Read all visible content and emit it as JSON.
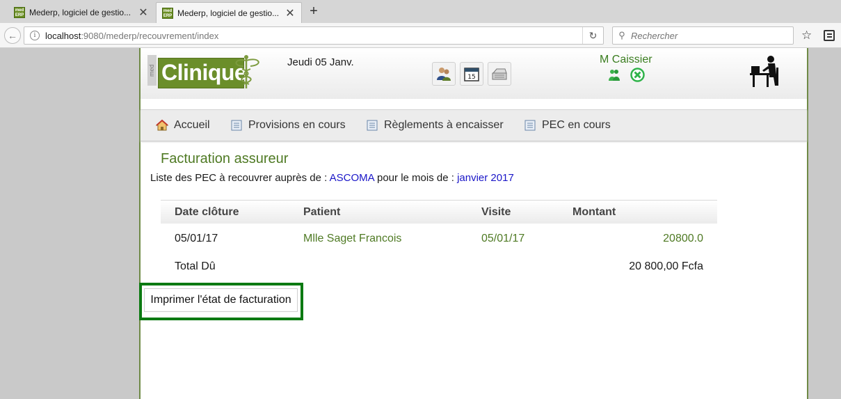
{
  "browser": {
    "tabs": [
      {
        "label": "Mederp, logiciel de gestio...",
        "favicon_text": "med ERP",
        "active": false
      },
      {
        "label": "Mederp, logiciel de gestio...",
        "favicon_text": "med ERP",
        "active": true
      }
    ],
    "url_host": "localhost",
    "url_path": ":9080/mederp/recouvrement/index",
    "search_placeholder": "Rechercher"
  },
  "header": {
    "logo_small": "med",
    "logo_text": "Clinique",
    "date": "Jeudi 05 Janv.",
    "calendar_day": "15",
    "user_name": "M Caissier",
    "quick_icons": [
      "patients-icon",
      "calendar-icon",
      "cash-register-icon"
    ]
  },
  "menu": [
    {
      "label": "Accueil",
      "icon": "home-icon"
    },
    {
      "label": "Provisions en cours",
      "icon": "document-icon"
    },
    {
      "label": "Règlements à encaisser",
      "icon": "document-icon"
    },
    {
      "label": "PEC en cours",
      "icon": "document-icon"
    }
  ],
  "main": {
    "title": "Facturation assureur",
    "subtitle_prefix": "Liste des PEC à recouvrer auprès de :",
    "insurer": "ASCOMA",
    "subtitle_middle": "pour le mois de :",
    "month": "janvier 2017",
    "table": {
      "headers": [
        "Date clôture",
        "Patient",
        "Visite",
        "Montant"
      ],
      "rows": [
        {
          "date": "05/01/17",
          "patient": "Mlle Saget Francois",
          "visite": "05/01/17",
          "montant": "20800.0"
        }
      ],
      "total_label": "Total Dû",
      "total_value": "20 800,00 Fcfa"
    },
    "print_button": "Imprimer l'état de facturation"
  },
  "colors": {
    "brand_green": "#6b8e2a",
    "text_green": "#4f7a24",
    "link_blue": "#1a16c8",
    "highlight_green": "#0c7a12"
  }
}
